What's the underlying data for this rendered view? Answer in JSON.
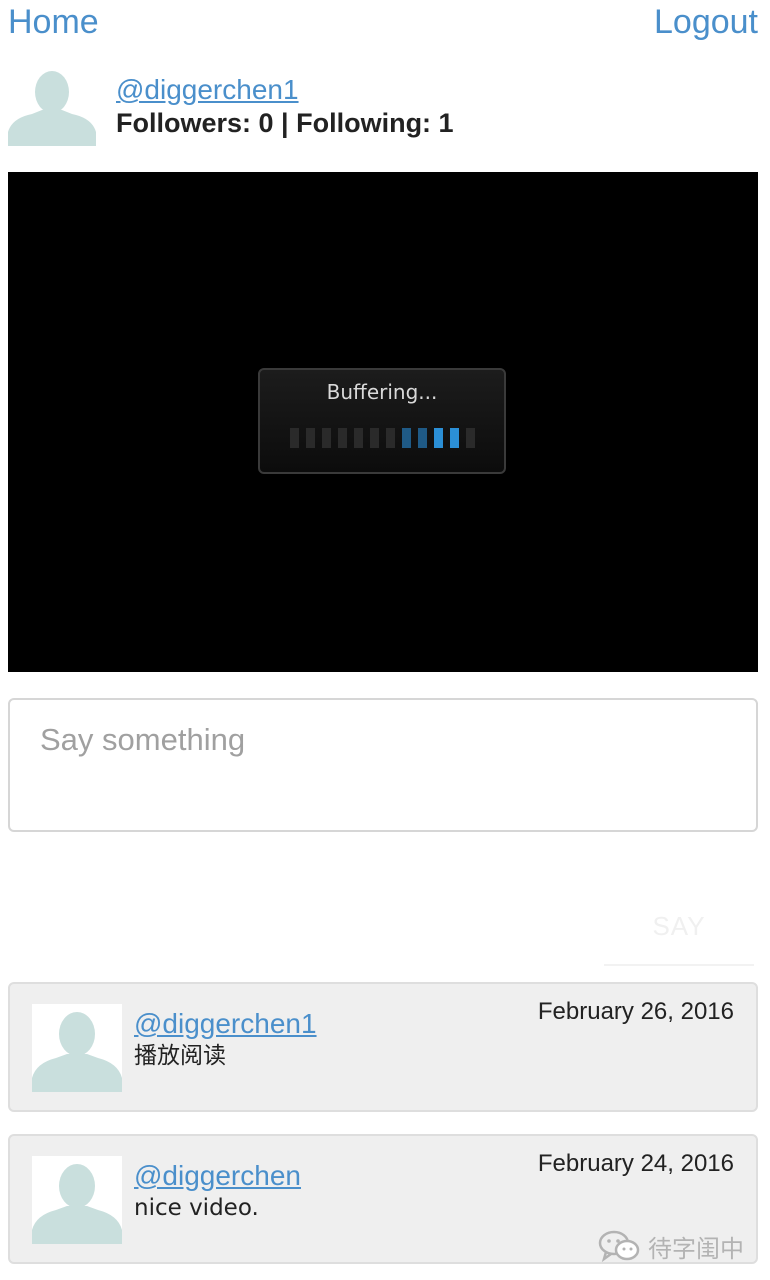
{
  "nav": {
    "home_label": "Home",
    "logout_label": "Logout"
  },
  "profile": {
    "avatar_icon": "default-person-silhouette-icon",
    "username": "@diggerchen1",
    "stats": "Followers: 0 | Following: 1"
  },
  "video": {
    "status_text": "Buffering...",
    "icon": "buffering-progress-bars-icon"
  },
  "comment_form": {
    "placeholder": "Say something",
    "value": "",
    "submit_label": "SAY"
  },
  "posts": [
    {
      "author": "@diggerchen1",
      "date": "February 26, 2016",
      "text": "播放阅读",
      "avatar_icon": "default-person-silhouette-icon"
    },
    {
      "author": "@diggerchen",
      "date": "February 24, 2016",
      "text": "nice video.",
      "avatar_icon": "default-person-silhouette-icon"
    }
  ],
  "watermark": {
    "icon": "wechat-icon",
    "text": "待字闺中"
  },
  "colors": {
    "link": "#4a8fcb",
    "avatar": "#c9dfdd",
    "buffer_accent": "#2b8fd6"
  }
}
